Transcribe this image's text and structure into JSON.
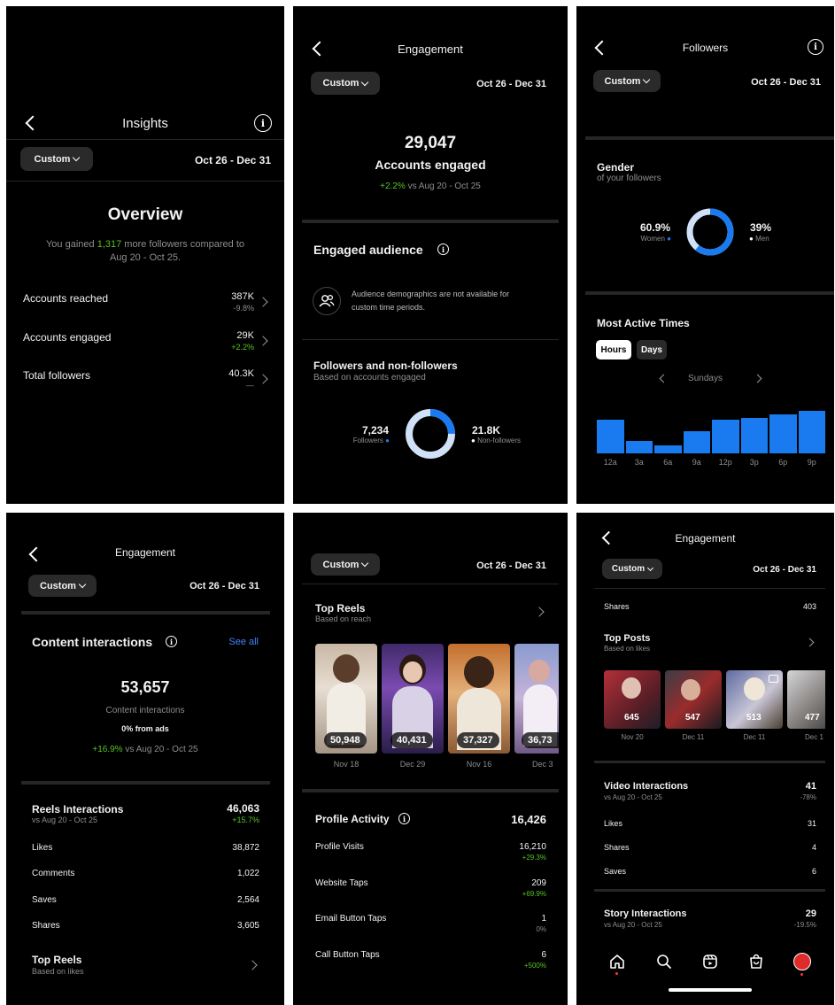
{
  "common": {
    "custom_label": "Custom",
    "date_range": "Oct 26 - Dec 31"
  },
  "p1": {
    "title": "Insights",
    "overview_title": "Overview",
    "gained_prefix": "You gained ",
    "gained_value": "1,317",
    "gained_suffix": " more followers compared to",
    "gained_line2": "Aug 20 - Oct 25.",
    "rows": [
      {
        "label": "Accounts reached",
        "value": "387K",
        "change": "-9.8%"
      },
      {
        "label": "Accounts engaged",
        "value": "29K",
        "change": "+2.2%"
      },
      {
        "label": "Total followers",
        "value": "40.3K",
        "change": "—"
      }
    ]
  },
  "p2": {
    "title": "Engagement",
    "big_number": "29,047",
    "big_label": "Accounts engaged",
    "change": "+2.2%",
    "change_suffix": " vs Aug 20 - Oct 25",
    "engaged_audience": "Engaged audience",
    "demographics_note_1": "Audience demographics are not available for",
    "demographics_note_2": "custom time periods.",
    "fnf_title": "Followers and non-followers",
    "fnf_sub": "Based on accounts engaged",
    "followers_value": "7,234",
    "followers_label": "Followers",
    "nonfollowers_value": "21.8K",
    "nonfollowers_label": "Non-followers",
    "followers_fraction": 0.249
  },
  "p3": {
    "title": "Followers",
    "gender_title": "Gender",
    "gender_sub": "of your followers",
    "women_value": "60.9%",
    "women_label": "Women",
    "men_value": "39%",
    "men_label": "Men",
    "women_fraction": 0.609,
    "active_title": "Most Active Times",
    "tab_hours": "Hours",
    "tab_days": "Days",
    "day_label": "Sundays",
    "bars": [
      {
        "label": "12a",
        "level": 0.58
      },
      {
        "label": "3a",
        "level": 0.22
      },
      {
        "label": "6a",
        "level": 0.14
      },
      {
        "label": "9a",
        "level": 0.38
      },
      {
        "label": "12p",
        "level": 0.58
      },
      {
        "label": "3p",
        "level": 0.62
      },
      {
        "label": "6p",
        "level": 0.68
      },
      {
        "label": "9p",
        "level": 0.74
      }
    ]
  },
  "p4": {
    "title": "Engagement",
    "ci_title": "Content interactions",
    "see_all": "See all",
    "big_number": "53,657",
    "big_label": "Content interactions",
    "from_ads": "0% from ads",
    "change": "+16.9%",
    "change_suffix": " vs Aug 20 - Oct 25",
    "reels_title": "Reels Interactions",
    "reels_sub": "vs Aug 20 - Oct 25",
    "reels_value": "46,063",
    "reels_change": "+15.7%",
    "rows": [
      {
        "label": "Likes",
        "value": "38,872"
      },
      {
        "label": "Comments",
        "value": "1,022"
      },
      {
        "label": "Saves",
        "value": "2,564"
      },
      {
        "label": "Shares",
        "value": "3,605"
      }
    ],
    "top_reels_title": "Top Reels",
    "top_reels_sub": "Based on likes"
  },
  "p5": {
    "top_reels_title": "Top Reels",
    "top_reels_sub": "Based on reach",
    "reels": [
      {
        "count": "50,948",
        "date": "Nov 18"
      },
      {
        "count": "40,431",
        "date": "Dec 29"
      },
      {
        "count": "37,327",
        "date": "Nov 16"
      },
      {
        "count": "36,73",
        "date": "Dec 3"
      }
    ],
    "activity_title": "Profile Activity",
    "activity_value": "16,426",
    "rows": [
      {
        "label": "Profile Visits",
        "value": "16,210",
        "change": "+29.3%"
      },
      {
        "label": "Website Taps",
        "value": "209",
        "change": "+69.9%"
      },
      {
        "label": "Email Button Taps",
        "value": "1",
        "change": "0%"
      },
      {
        "label": "Call Button Taps",
        "value": "6",
        "change": "+500%"
      }
    ]
  },
  "p6": {
    "title": "Engagement",
    "shares_label": "Shares",
    "shares_value": "403",
    "top_posts_title": "Top Posts",
    "top_posts_sub": "Based on likes",
    "posts": [
      {
        "count": "645",
        "date": "Nov 20"
      },
      {
        "count": "547",
        "date": "Dec 11"
      },
      {
        "count": "513",
        "date": "Dec 11"
      },
      {
        "count": "477",
        "date": "Dec 1"
      }
    ],
    "video_title": "Video Interactions",
    "video_sub": "vs Aug 20 - Oct 25",
    "video_value": "41",
    "video_change": "-78%",
    "video_rows": [
      {
        "label": "Likes",
        "value": "31"
      },
      {
        "label": "Shares",
        "value": "4"
      },
      {
        "label": "Saves",
        "value": "6"
      }
    ],
    "story_title": "Story Interactions",
    "story_sub": "vs Aug 20 - Oct 25",
    "story_value": "29",
    "story_change": "-19.5%"
  },
  "colors": {
    "accent_blue": "#1a7bf0",
    "positive_green": "#58c322",
    "notification_red": "#ff3040"
  }
}
